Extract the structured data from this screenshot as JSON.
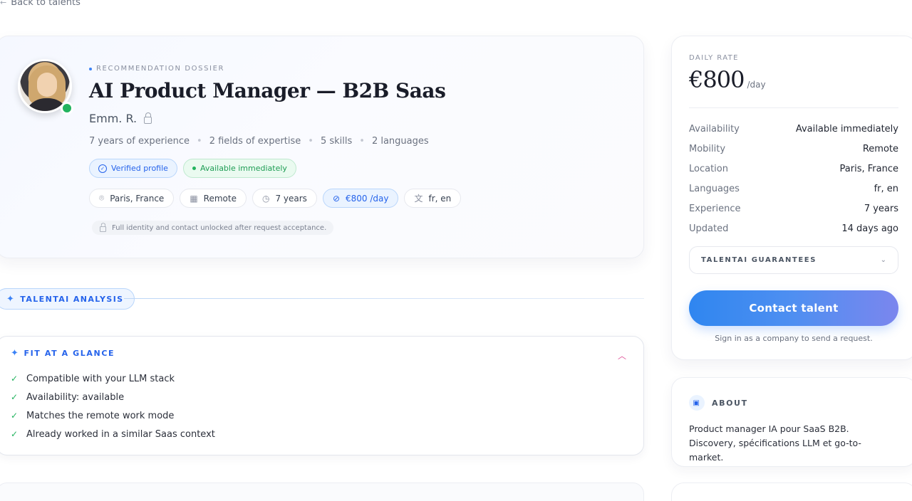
{
  "nav": {
    "back_label": "Back to talents"
  },
  "profile": {
    "eyebrow": "RECOMMENDATION DOSSIER",
    "title": "AI Product Manager — B2B Saas",
    "name": "Emm. R.",
    "stats": [
      "7 years of experience",
      "2 fields of expertise",
      "5 skills",
      "2 languages"
    ],
    "badges": {
      "verified": "Verified profile",
      "available": "Available immediately"
    },
    "chips": {
      "location": "Paris, France",
      "mode": "Remote",
      "experience": "7 years",
      "rate": "€800 /day",
      "languages": "fr, en"
    },
    "notice": "Full identity and contact unlocked after request acceptance."
  },
  "analysis": {
    "label": "TALENTAI ANALYSIS"
  },
  "fit": {
    "header": "FIT AT A GLANCE",
    "items": [
      "Compatible with your LLM stack",
      "Availability: available",
      "Matches the remote work mode",
      "Already worked in a similar Saas context"
    ]
  },
  "rate_card": {
    "label": "DAILY RATE",
    "amount": "€800",
    "unit": "/day",
    "details": [
      {
        "k": "Availability",
        "v": "Available immediately"
      },
      {
        "k": "Mobility",
        "v": "Remote"
      },
      {
        "k": "Location",
        "v": "Paris, France"
      },
      {
        "k": "Languages",
        "v": "fr, en"
      },
      {
        "k": "Experience",
        "v": "7 years"
      },
      {
        "k": "Updated",
        "v": "14 days ago"
      }
    ],
    "guarantees_label": "TALENTAI GUARANTEES",
    "contact_label": "Contact talent",
    "signin_note": "Sign in as a company to send a request."
  },
  "about": {
    "header": "ABOUT",
    "text": "Product manager IA pour SaaS B2B. Discovery, spécifications LLM et go-to-market."
  },
  "colors": {
    "accent": "#2563eb",
    "success": "#22b35e",
    "button_start": "#2f86f0",
    "button_end": "#7b86ee"
  }
}
